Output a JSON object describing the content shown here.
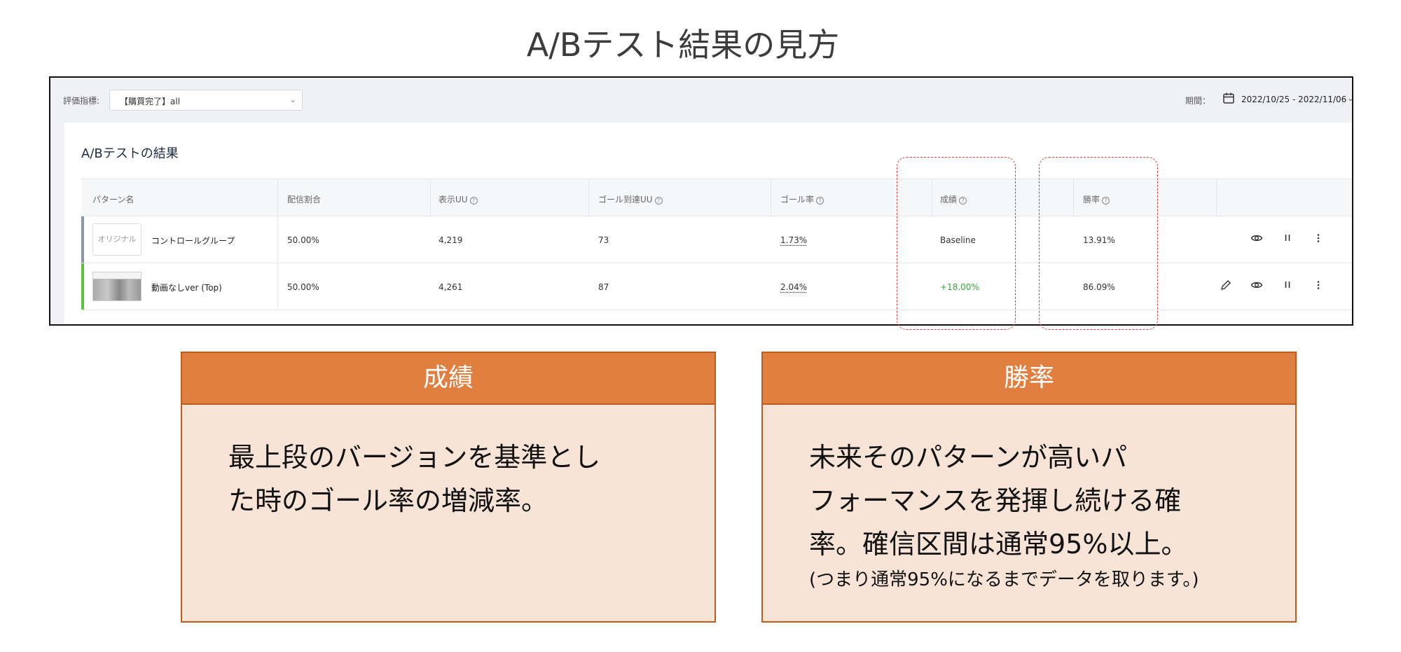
{
  "page_title": "A/Bテスト結果の見方",
  "filter_bar": {
    "metric_label": "評価指標:",
    "metric_value": "【購買完了】all",
    "period_label": "期間：",
    "period_value": "2022/10/25 - 2022/11/06"
  },
  "results": {
    "title": "A/Bテストの結果",
    "columns": [
      "パターン名",
      "配信割合",
      "表示UU",
      "ゴール到達UU",
      "ゴール率",
      "成績",
      "勝率"
    ],
    "rows": [
      {
        "thumbnail_text": "オリジナル",
        "name": "コントロールグループ",
        "share": "50.00%",
        "uu": "4,219",
        "goal_uu": "73",
        "goal_rate": "1.73%",
        "score": "Baseline",
        "win_rate": "13.91%",
        "bar_color": "#8a96a8"
      },
      {
        "thumbnail_text": "",
        "name": "動画なしver (Top)",
        "share": "50.00%",
        "uu": "4,261",
        "goal_uu": "87",
        "goal_rate": "2.04%",
        "score": "+18.00%",
        "win_rate": "86.09%",
        "bar_color": "#5cc43a"
      }
    ]
  },
  "cards": {
    "score": {
      "title": "成績",
      "line1": "最上段のバージョンを基準とし",
      "line2": "た時のゴール率の増減率。"
    },
    "win_rate": {
      "title": "勝率",
      "line1": "未来そのパターンが高いパ",
      "line2": "フォーマンスを発揮し続ける確",
      "line3": "率。確信区間は通常95%以上。",
      "note": "(つまり通常95%になるまでデータを取ります。)"
    }
  },
  "colors": {
    "card_header": "#e07f3f",
    "card_body": "#f7e4d6",
    "highlight": "#e23b3b",
    "positive": "#3aa637"
  }
}
